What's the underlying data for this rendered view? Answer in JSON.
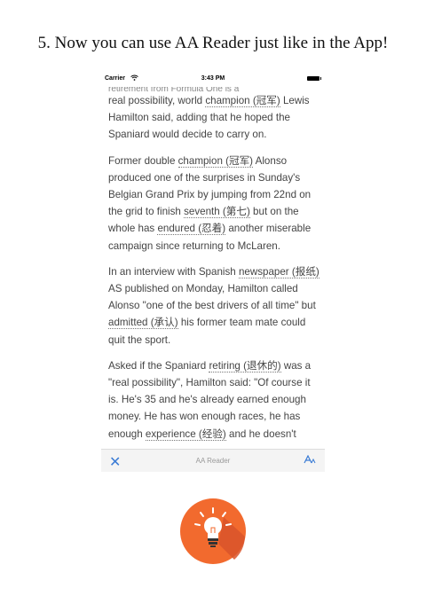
{
  "headline": "5. Now you can use AA Reader just like in the App!",
  "status_bar": {
    "carrier": "Carrier",
    "time": "3:43 PM"
  },
  "article": {
    "top_clipped_line": "retirement from Formula One is a",
    "paragraphs": [
      [
        {
          "t": "real possibility, world "
        },
        {
          "t": "champion (冠军)",
          "g": true
        },
        {
          "t": " Lewis Hamilton said, adding that he hoped the Spaniard would decide to carry on."
        }
      ],
      [
        {
          "t": "Former double "
        },
        {
          "t": "champion (冠军)",
          "g": true
        },
        {
          "t": " Alonso produced one of the surprises in Sunday's Belgian Grand Prix by jumping from 22nd on the grid to finish "
        },
        {
          "t": "seventh (第七)",
          "g": true
        },
        {
          "t": " but on the whole has "
        },
        {
          "t": "endured (忍着)",
          "g": true
        },
        {
          "t": " another miserable campaign since returning to McLaren."
        }
      ],
      [
        {
          "t": "In an interview with Spanish "
        },
        {
          "t": "newspaper (报纸)",
          "g": true
        },
        {
          "t": " AS published on Monday, Hamilton called Alonso \"one of the best drivers of all time\" but "
        },
        {
          "t": "admitted (承认)",
          "g": true
        },
        {
          "t": " his former team mate could quit the sport."
        }
      ],
      [
        {
          "t": "Asked if the Spaniard "
        },
        {
          "t": "retiring (退休的)",
          "g": true
        },
        {
          "t": " was a \"real possibility\", Hamilton said: \"Of course it is. He's 35 and he's already earned enough money. He has won enough races, he has enough "
        },
        {
          "t": "experience (经验)",
          "g": true
        },
        {
          "t": " and he doesn't"
        }
      ]
    ]
  },
  "toolbar": {
    "close_icon": "close-icon",
    "title": "AA Reader",
    "font_icon": "font-size-icon"
  },
  "logo": {
    "icon": "lightbulb-icon",
    "colors": {
      "circle": "#f26a2e",
      "shadow": "#d9532a",
      "bulb": "#ffffff",
      "base": "#333333"
    }
  },
  "colors": {
    "accent": "#3a7bd5",
    "text": "#444444"
  }
}
